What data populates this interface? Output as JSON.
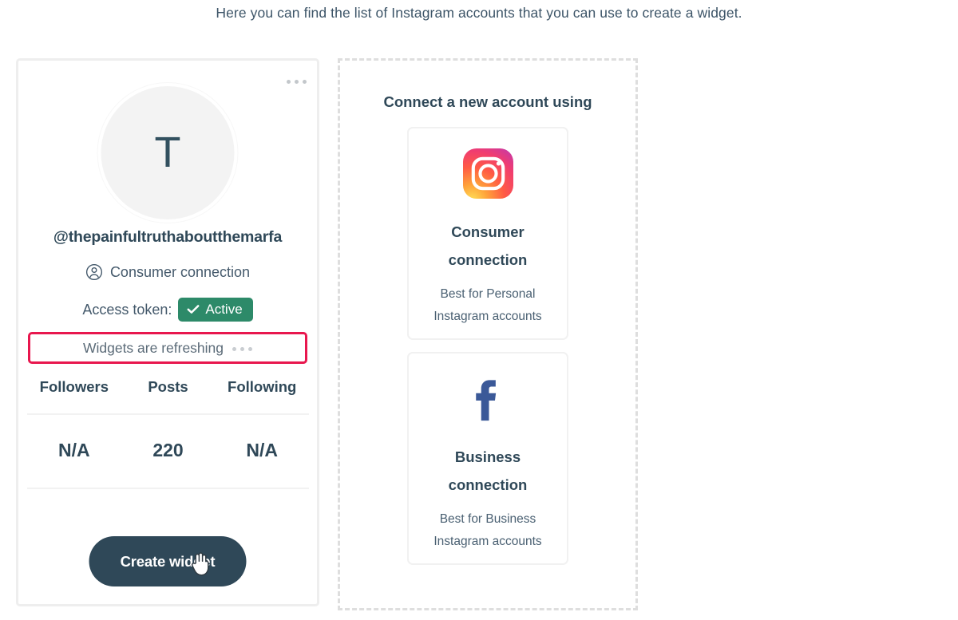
{
  "page": {
    "intro": "Here you can find the list of Instagram accounts that you can use to create a widget."
  },
  "colors": {
    "text_dark": "#2f4858",
    "text_muted": "#4a6072",
    "badge_green": "#2d8a69",
    "alert_red": "#e8174e",
    "facebook_blue": "#3b5998",
    "card_border": "#eeeeee",
    "dashed_border": "#dedede",
    "button_bg": "#2f4858"
  },
  "account_card": {
    "menu_icon": "kebab-menu-icon",
    "avatar": {
      "icon": "avatar",
      "initial": "T"
    },
    "handle": "@thepainfultruthaboutthemarfa",
    "connection": {
      "icon": "user-circle-icon",
      "label": "Consumer connection"
    },
    "access_token": {
      "label": "Access token:",
      "badge_icon": "check-icon",
      "badge_label": "Active"
    },
    "refresh_notice": {
      "text": "Widgets are refreshing",
      "dots_icon": "loading-dots-icon"
    },
    "stats": {
      "headers": [
        "Followers",
        "Posts",
        "Following"
      ],
      "values": [
        "N/A",
        "220",
        "N/A"
      ]
    },
    "create_button": "Create widget"
  },
  "connect_panel": {
    "title": "Connect a new account using",
    "options": [
      {
        "icon": "instagram-icon",
        "title_line1": "Consumer",
        "title_line2": "connection",
        "sub_line1": "Best for Personal",
        "sub_line2": "Instagram accounts"
      },
      {
        "icon": "facebook-icon",
        "title_line1": "Business",
        "title_line2": "connection",
        "sub_line1": "Best for Business",
        "sub_line2": "Instagram accounts"
      }
    ]
  },
  "cursor": {
    "icon": "pointing-hand-cursor"
  }
}
